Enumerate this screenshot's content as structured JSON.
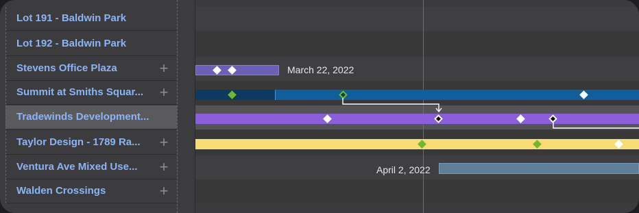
{
  "rows": [
    {
      "label": "Lot 191 - Baldwin Park",
      "has_add": false,
      "selected": false
    },
    {
      "label": "Lot 192 - Baldwin Park",
      "has_add": false,
      "selected": false
    },
    {
      "label": "Stevens Office Plaza",
      "has_add": true,
      "selected": false
    },
    {
      "label": "Summit at Smiths Squar...",
      "has_add": true,
      "selected": false
    },
    {
      "label": "Tradewinds Development...",
      "has_add": false,
      "selected": true
    },
    {
      "label": "Taylor Design - 1789 Ra...",
      "has_add": true,
      "selected": false
    },
    {
      "label": "Ventura Ave Mixed Use...",
      "has_add": true,
      "selected": false
    },
    {
      "label": "Walden Crossings",
      "has_add": true,
      "selected": false
    }
  ],
  "add_icon": "+",
  "date_labels": {
    "stevens": "March 22, 2022",
    "ventura": "April 2, 2022"
  },
  "colors": {
    "bar_purple_light": "#6b5fb8",
    "bar_navy": "#0b3a62",
    "bar_blue": "#0f5f9f",
    "bar_violet": "#8b5fdc",
    "bar_yellow": "#f6dc73",
    "bar_steel": "#5e7f99",
    "milestone_green": "#6fb832",
    "link_color": "#ffffff",
    "name_text": "#8ab4f5"
  }
}
